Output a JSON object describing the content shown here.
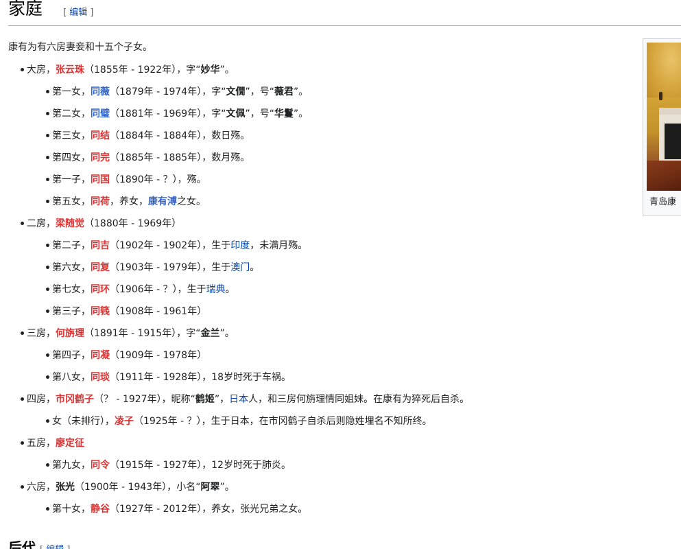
{
  "section": {
    "title": "家庭",
    "edit_open": "[ ",
    "edit_label": "编辑",
    "edit_close": " ]"
  },
  "intro": "康有为有六房妻妾和十五个子女。",
  "rows": [
    {
      "segs": [
        "大房，",
        "张云珠",
        "（1855年 - 1922年），字“",
        "妙华",
        "”。"
      ]
    },
    {
      "segs": [
        "第一女，",
        "同薇",
        "（1879年 - 1974年），字“",
        "文僩",
        "”，号“",
        "薇君",
        "”。"
      ]
    },
    {
      "segs": [
        "第二女，",
        "同璧",
        "（1881年 - 1969年），字“",
        "文佩",
        "”，号“",
        "华鬘",
        "”。"
      ]
    },
    {
      "segs": [
        "第三女，",
        "同结",
        "（1884年 - 1884年），数日殇。"
      ]
    },
    {
      "segs": [
        "第四女，",
        "同完",
        "（1885年 - 1885年），数月殇。"
      ]
    },
    {
      "segs": [
        "第一子，",
        "同国",
        "（1890年 - ？），殇。"
      ]
    },
    {
      "segs": [
        "第五女，",
        "同荷",
        "，养女，",
        "康有溥",
        "之女。"
      ]
    },
    {
      "segs": [
        "二房，",
        "梁随觉",
        "（1880年 - 1969年）"
      ]
    },
    {
      "segs": [
        "第二子，",
        "同吉",
        "（1902年 - 1902年），生于",
        "印度",
        "，未满月殇。"
      ]
    },
    {
      "segs": [
        "第六女，",
        "同复",
        "（1903年 - 1979年），生于",
        "澳门",
        "。"
      ]
    },
    {
      "segs": [
        "第七女，",
        "同环",
        "（1906年 - ？），生于",
        "瑞典",
        "。"
      ]
    },
    {
      "segs": [
        "第三子，",
        "同篯",
        "（1908年 - 1961年）"
      ]
    },
    {
      "segs": [
        "三房，",
        "何旃理",
        "（1891年 - 1915年），字“",
        "金兰",
        "”。"
      ]
    },
    {
      "segs": [
        "第四子，",
        "同凝",
        "（1909年 - 1978年）"
      ]
    },
    {
      "segs": [
        "第八女，",
        "同琰",
        "（1911年 - 1928年），18岁时死于车祸。"
      ]
    },
    {
      "segs": [
        "四房，",
        "市冈鹤子",
        "（？ - 1927年），昵称“",
        "鹤姬",
        "”，",
        "日本",
        "人，和三房何旃理情同姐妹。在康有为猝死后自杀。"
      ]
    },
    {
      "segs": [
        "女（未排行），",
        "凌子",
        "（1925年 - ？），生于日本，在市冈鹤子自杀后则隐姓埋名不知所终。"
      ]
    },
    {
      "segs": [
        "五房，",
        "廖定征"
      ]
    },
    {
      "segs": [
        "第九女，",
        "同令",
        "（1915年 - 1927年），12岁时死于肺炎。"
      ]
    },
    {
      "segs": [
        "六房，",
        "张光",
        "（1900年 - 1943年），小名“",
        "阿翠",
        "”。"
      ]
    },
    {
      "segs": [
        "第十女，",
        "静谷",
        "（1927年 - 2012年），养女，张光兄弟之女。"
      ]
    }
  ],
  "thumbnail": {
    "caption": "青岛康"
  },
  "next_section": {
    "title": "后代",
    "edit_open": "[ ",
    "edit_label": "编辑",
    "edit_close": " ]"
  },
  "colors": {
    "redlink": "#dd3333",
    "bluelink": "#3366cc",
    "link": "#0645ad"
  }
}
